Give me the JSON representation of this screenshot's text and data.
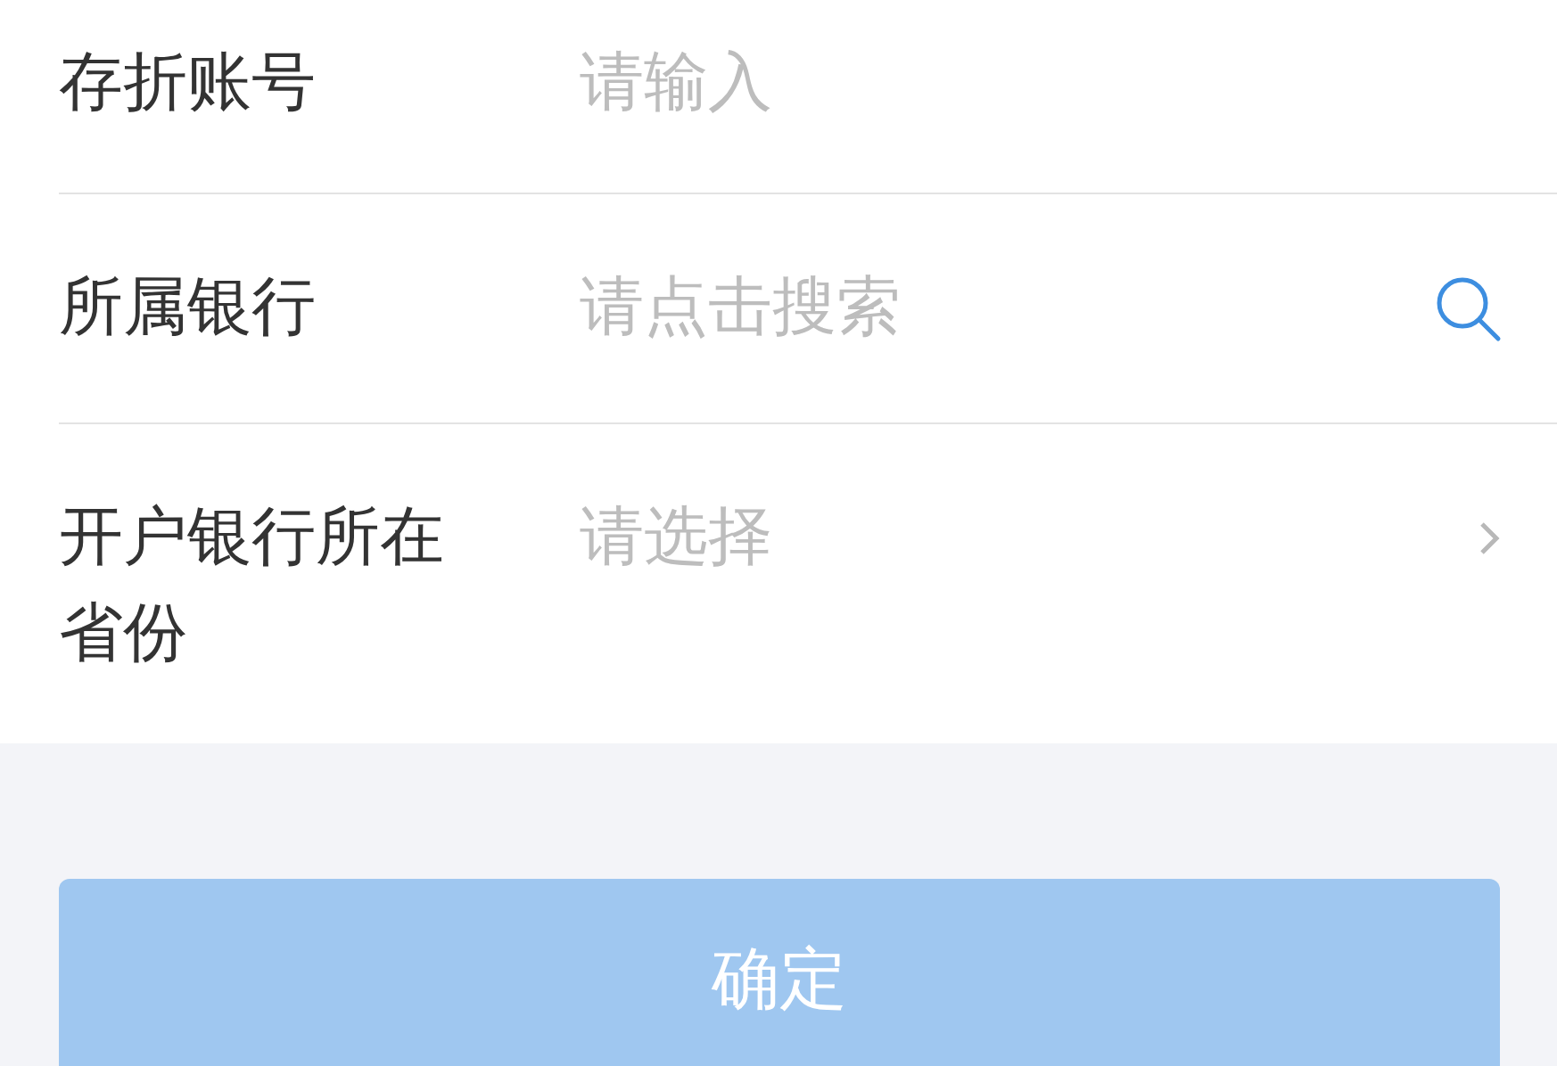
{
  "fields": [
    {
      "label": "存折账号",
      "placeholder": "请输入",
      "kind": "text"
    },
    {
      "label": "所属银行",
      "placeholder": "请点击搜索",
      "kind": "search"
    },
    {
      "label": "开户银行所在省份",
      "placeholder": "请选择",
      "kind": "select"
    }
  ],
  "confirm_button": {
    "label": "确定",
    "disabled": true
  }
}
